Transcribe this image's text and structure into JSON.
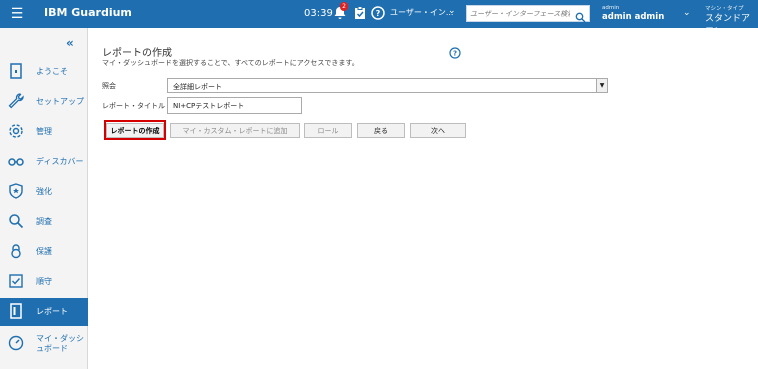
{
  "topbar": {
    "brand": "IBM Guardium",
    "time": "03:39",
    "notification_count": "2",
    "ui_select_value": "ユーザー・イン...",
    "search_placeholder": "ユーザー・インターフェース検索",
    "user_role": "admin",
    "user_name": "admin admin",
    "deploy_mode_label": "マシン・タイプ",
    "deploy_type": "スタンドアロン",
    "accent_color": "#1f6fb0"
  },
  "sidebar": {
    "items": [
      {
        "label": "ようこそ",
        "icon": "welcome-icon"
      },
      {
        "label": "セットアップ",
        "icon": "wrench-icon"
      },
      {
        "label": "管理",
        "icon": "gear-icon"
      },
      {
        "label": "ディスカバー",
        "icon": "binoculars-icon"
      },
      {
        "label": "強化",
        "icon": "shield-icon"
      },
      {
        "label": "調査",
        "icon": "search-icon"
      },
      {
        "label": "保護",
        "icon": "lock-icon"
      },
      {
        "label": "順守",
        "icon": "checkbox-icon"
      },
      {
        "label": "レポート",
        "icon": "report-icon"
      },
      {
        "label": "マイ・ダッシュボード",
        "icon": "dashboard-icon"
      }
    ],
    "active_index": 8
  },
  "main": {
    "title": "レポートの作成",
    "description": "マイ・ダッシュボードを選択することで、すべてのレポートにアクセスできます。",
    "query_label": "照会",
    "query_value": "全詳細レポート",
    "report_title_label": "レポート・タイトル",
    "report_title_value": "NI+CPテストレポート",
    "buttons": {
      "create": "レポートの作成",
      "add_to_custom": "マイ・カスタム・レポートに追加",
      "roles": "ロール",
      "back": "戻る",
      "next": "次へ"
    }
  }
}
